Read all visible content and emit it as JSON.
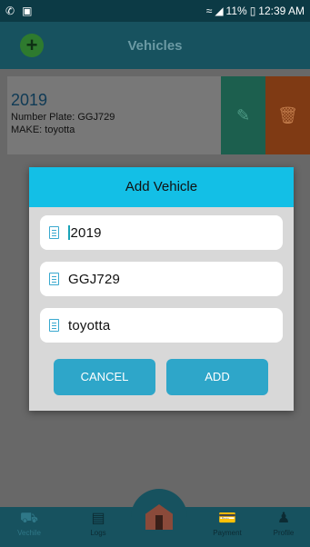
{
  "status_bar": {
    "left_icons": [
      "phone-icon",
      "image-icon"
    ],
    "battery": "11%",
    "time": "12:39 AM"
  },
  "app_bar": {
    "title": "Vehicles",
    "add_icon": "plus-circle-icon"
  },
  "vehicle_card": {
    "year": "2019",
    "plate_line": "Number Plate:  GGJ729",
    "make_line": "MAKE:  toyotta",
    "edit_icon": "pencil-icon",
    "delete_icon": "trash-icon"
  },
  "dialog": {
    "title": "Add Vehicle",
    "fields": [
      {
        "value": "2019"
      },
      {
        "value": "GGJ729"
      },
      {
        "value": "toyotta"
      }
    ],
    "cancel_label": "CANCEL",
    "add_label": "ADD"
  },
  "bottom_nav": {
    "items": [
      {
        "label": "Vechile",
        "icon": "car-icon"
      },
      {
        "label": "Logs",
        "icon": "logs-icon"
      },
      {
        "label": "Payment",
        "icon": "payment-icon"
      },
      {
        "label": "Profile",
        "icon": "profile-icon"
      }
    ],
    "home_icon": "home-icon"
  },
  "colors": {
    "header": "#17525f",
    "dialog_header": "#13bfe6",
    "button": "#2ea6c9",
    "edit": "#1c5f4e",
    "delete": "#7f3a14"
  }
}
